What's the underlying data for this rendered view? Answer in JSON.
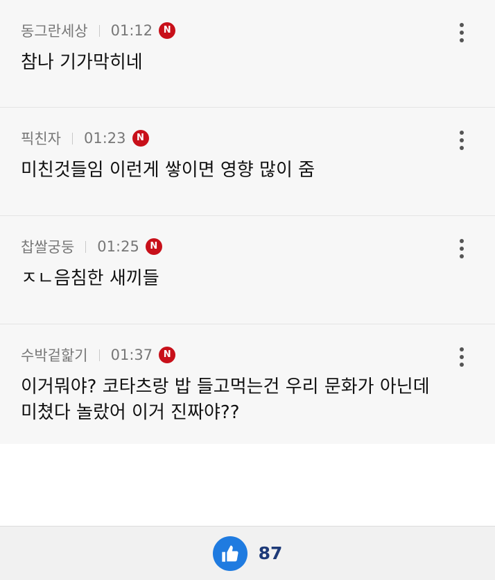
{
  "comments": [
    {
      "author": "동그란세상",
      "time": "01:12",
      "badge": "N",
      "text": "참나 기가막히네"
    },
    {
      "author": "픽친자",
      "time": "01:23",
      "badge": "N",
      "text": "미친것들임 이런게 쌓이면 영향 많이 줌"
    },
    {
      "author": "찹쌀궁둥",
      "time": "01:25",
      "badge": "N",
      "text": "ㅈㄴ음침한 새끼들"
    },
    {
      "author": "수박겉핥기",
      "time": "01:37",
      "badge": "N",
      "text": "이거뭐야? 코타츠랑 밥 들고먹는건 우리 문화가 아닌데 미쳤다 놀랐어 이거 진짜야??"
    }
  ],
  "like": {
    "count": "87"
  },
  "colors": {
    "badge_red": "#c8101a",
    "like_blue": "#1f7be0",
    "like_count": "#1e3a78"
  },
  "icons": {
    "more": "more-vertical-icon",
    "new_badge": "new-badge-icon",
    "like": "thumbs-up-icon"
  }
}
